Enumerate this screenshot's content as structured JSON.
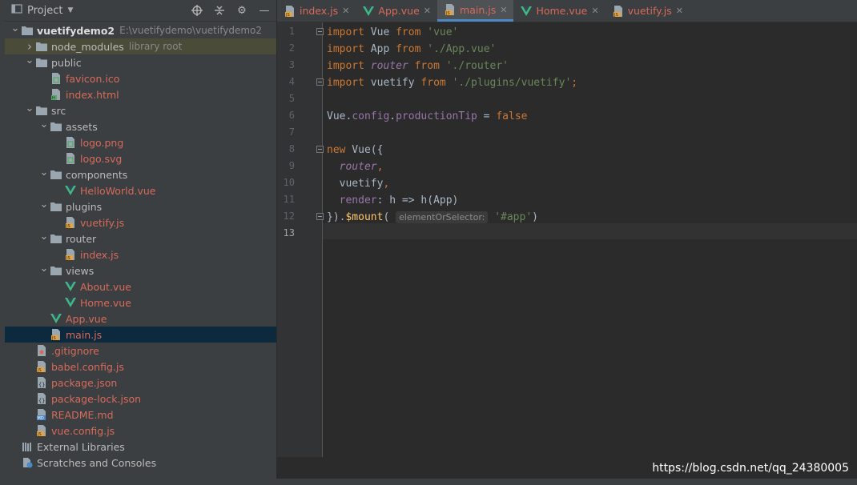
{
  "project_panel": {
    "title": "Project",
    "tools": [
      "crosshair-icon",
      "collapse-icon",
      "gear-icon",
      "minimize-icon"
    ]
  },
  "tree": [
    {
      "label": "vuetifydemo2",
      "path": "E:\\vuetifydemo\\vuetifydemo2",
      "icon": "folder-icon",
      "indent": 0,
      "chevron": "down",
      "bold": true
    },
    {
      "label": "node_modules",
      "path": "library root",
      "icon": "folder-icon",
      "indent": 1,
      "chevron": "right",
      "hover": true
    },
    {
      "label": "public",
      "icon": "folder-icon",
      "indent": 1,
      "chevron": "down"
    },
    {
      "label": "favicon.ico",
      "icon": "image-file-icon",
      "indent": 2,
      "modified": true
    },
    {
      "label": "index.html",
      "icon": "html-file-icon",
      "indent": 2,
      "modified": true
    },
    {
      "label": "src",
      "icon": "folder-icon",
      "indent": 1,
      "chevron": "down"
    },
    {
      "label": "assets",
      "icon": "folder-icon",
      "indent": 2,
      "chevron": "down"
    },
    {
      "label": "logo.png",
      "icon": "image-file-icon",
      "indent": 3,
      "modified": true
    },
    {
      "label": "logo.svg",
      "icon": "image-file-icon",
      "indent": 3,
      "modified": true
    },
    {
      "label": "components",
      "icon": "folder-icon",
      "indent": 2,
      "chevron": "down"
    },
    {
      "label": "HelloWorld.vue",
      "icon": "vue-icon",
      "indent": 3,
      "modified": true
    },
    {
      "label": "plugins",
      "icon": "folder-icon",
      "indent": 2,
      "chevron": "down"
    },
    {
      "label": "vuetify.js",
      "icon": "js-file-icon",
      "indent": 3,
      "modified": true
    },
    {
      "label": "router",
      "icon": "folder-icon",
      "indent": 2,
      "chevron": "down"
    },
    {
      "label": "index.js",
      "icon": "js-file-icon",
      "indent": 3,
      "modified": true
    },
    {
      "label": "views",
      "icon": "folder-icon",
      "indent": 2,
      "chevron": "down"
    },
    {
      "label": "About.vue",
      "icon": "vue-icon",
      "indent": 3,
      "modified": true
    },
    {
      "label": "Home.vue",
      "icon": "vue-icon",
      "indent": 3,
      "modified": true
    },
    {
      "label": "App.vue",
      "icon": "vue-icon",
      "indent": 2,
      "modified": true
    },
    {
      "label": "main.js",
      "icon": "js-file-icon",
      "indent": 2,
      "modified": true,
      "selected": true
    },
    {
      "label": ".gitignore",
      "icon": "git-file-icon",
      "indent": 1,
      "modified": true
    },
    {
      "label": "babel.config.js",
      "icon": "js-file-icon",
      "indent": 1,
      "modified": true
    },
    {
      "label": "package.json",
      "icon": "json-file-icon",
      "indent": 1,
      "modified": true
    },
    {
      "label": "package-lock.json",
      "icon": "json-file-icon",
      "indent": 1,
      "modified": true
    },
    {
      "label": "README.md",
      "icon": "markdown-file-icon",
      "indent": 1,
      "modified": true
    },
    {
      "label": "vue.config.js",
      "icon": "js-file-icon",
      "indent": 1,
      "modified": true
    },
    {
      "label": "External Libraries",
      "icon": "libraries-icon",
      "indent": 0
    },
    {
      "label": "Scratches and Consoles",
      "icon": "scratches-icon",
      "indent": 0
    }
  ],
  "tabs": [
    {
      "label": "index.js",
      "icon": "js-file-icon",
      "active": false
    },
    {
      "label": "App.vue",
      "icon": "vue-icon",
      "active": false
    },
    {
      "label": "main.js",
      "icon": "js-file-icon",
      "active": true
    },
    {
      "label": "Home.vue",
      "icon": "vue-icon",
      "active": false
    },
    {
      "label": "vuetify.js",
      "icon": "js-file-icon",
      "active": false
    }
  ],
  "editor": {
    "current_line": 13,
    "line_numbers": [
      "1",
      "2",
      "3",
      "4",
      "5",
      "6",
      "7",
      "8",
      "9",
      "10",
      "11",
      "12",
      "13"
    ],
    "lines": [
      [
        {
          "t": "import",
          "c": "kw"
        },
        {
          "t": " Vue "
        },
        {
          "t": "from",
          "c": "kw"
        },
        {
          "t": " "
        },
        {
          "t": "'vue'",
          "c": "str"
        }
      ],
      [
        {
          "t": "import",
          "c": "kw"
        },
        {
          "t": " App "
        },
        {
          "t": "from",
          "c": "kw"
        },
        {
          "t": " "
        },
        {
          "t": "'./App.vue'",
          "c": "str"
        }
      ],
      [
        {
          "t": "import",
          "c": "kw"
        },
        {
          "t": " "
        },
        {
          "t": "router",
          "c": "it"
        },
        {
          "t": " "
        },
        {
          "t": "from",
          "c": "kw"
        },
        {
          "t": " "
        },
        {
          "t": "'./router'",
          "c": "str"
        }
      ],
      [
        {
          "t": "import",
          "c": "kw"
        },
        {
          "t": " vuetify "
        },
        {
          "t": "from",
          "c": "kw"
        },
        {
          "t": " "
        },
        {
          "t": "'./plugins/vuetify'",
          "c": "str"
        },
        {
          "t": ";",
          "c": "kw"
        }
      ],
      [],
      [
        {
          "t": "Vue."
        },
        {
          "t": "config",
          "c": "prop"
        },
        {
          "t": "."
        },
        {
          "t": "productionTip",
          "c": "prop"
        },
        {
          "t": " = "
        },
        {
          "t": "false",
          "c": "kw"
        }
      ],
      [],
      [
        {
          "t": "new",
          "c": "kw"
        },
        {
          "t": " Vue({"
        }
      ],
      [
        {
          "t": "  "
        },
        {
          "t": "router",
          "c": "it"
        },
        {
          "t": ",",
          "c": "kw"
        }
      ],
      [
        {
          "t": "  vuetify"
        },
        {
          "t": ",",
          "c": "kw"
        }
      ],
      [
        {
          "t": "  "
        },
        {
          "t": "render",
          "c": "prop"
        },
        {
          "t": ": h => h(App)"
        }
      ],
      [
        {
          "t": "})."
        },
        {
          "t": "$mount",
          "c": "fn"
        },
        {
          "t": "( "
        },
        {
          "t": "elementOrSelector:",
          "c": "hint"
        },
        {
          "t": " "
        },
        {
          "t": "'#app'",
          "c": "str"
        },
        {
          "t": ")"
        }
      ],
      []
    ]
  },
  "watermark": "https://blog.csdn.net/qq_24380005",
  "colors": {
    "modified": "#d66a5b",
    "selected": "#0d293e",
    "accent": "#4a88c7"
  }
}
